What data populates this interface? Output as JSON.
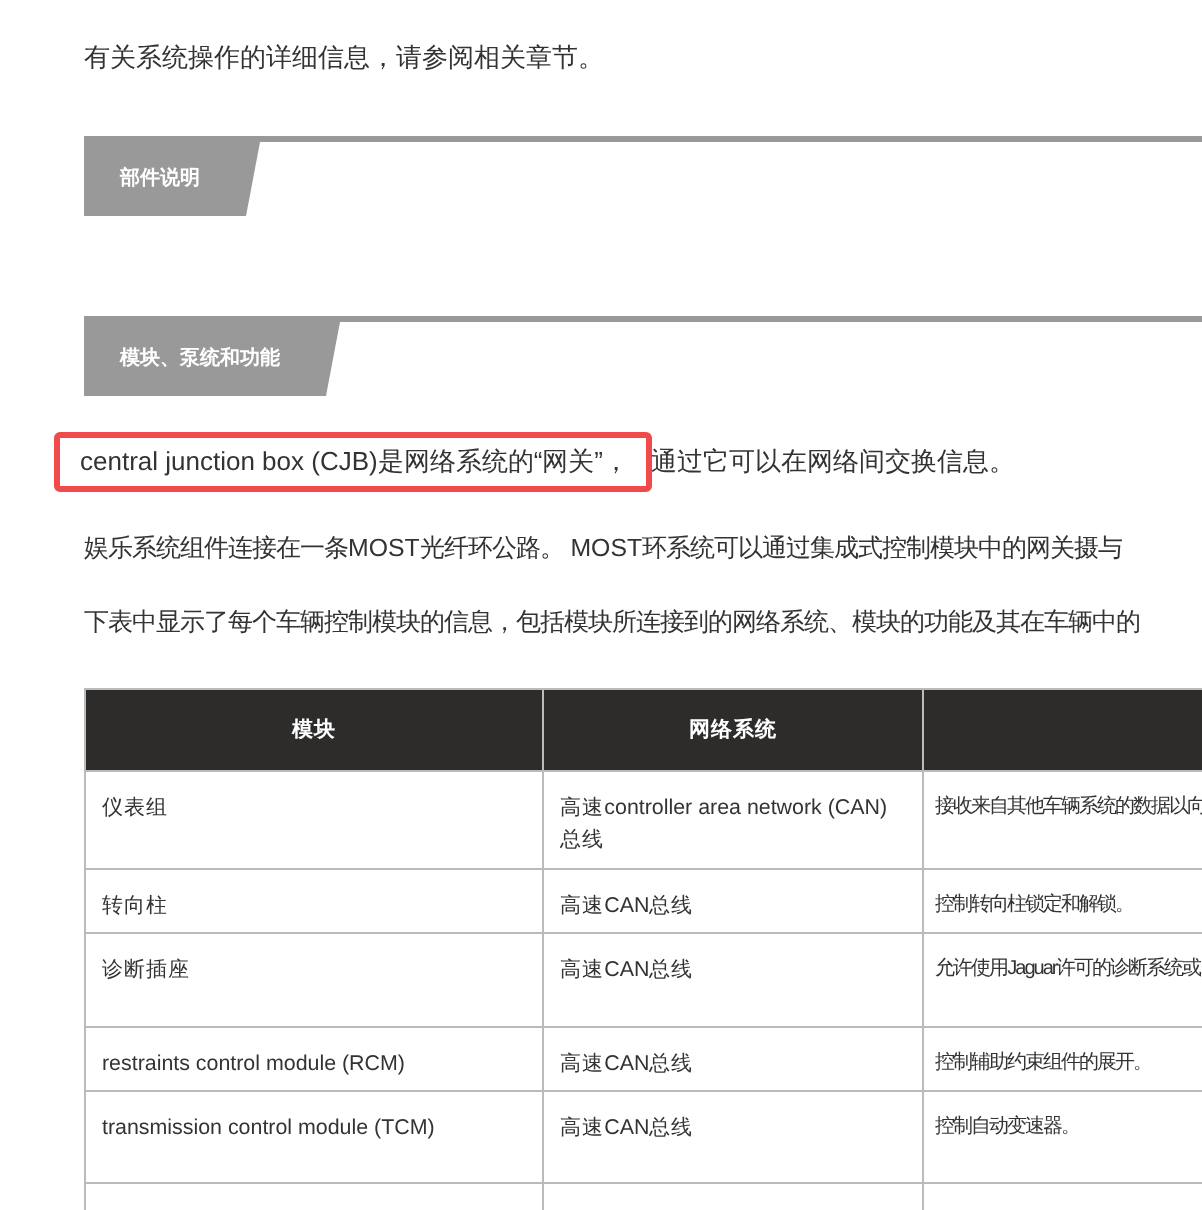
{
  "intro": "有关系统操作的详细信息，请参阅相关章节。",
  "sections": [
    {
      "title": "部件说明"
    },
    {
      "title": "模块、泵统和功能"
    }
  ],
  "highlight": {
    "marked": "central junction box (CJB)是网络系统的“网关”，",
    "rest": "通过它可以在网络间交换信息。"
  },
  "paragraphs": [
    "娱乐系统组件连接在一条MOST光纤环公路。 MOST环系统可以通过集成式控制模块中的网关摄与",
    "下表中显示了每个车辆控制模块的信息，包括模块所连接到的网络系统、模块的功能及其在车辆中的"
  ],
  "table": {
    "columns": [
      "模块",
      "网络系统"
    ],
    "rows": [
      [
        "仪表组",
        "高速controller area network (CAN)总线",
        "接收来自其他车辆系统的数据以向"
      ],
      [
        "转向柱",
        "高速CAN总线",
        "控制转向柱锁定和解锁。"
      ],
      [
        "诊断插座",
        "高速CAN总线",
        "允许使用Jaguar许可的诊断系统或"
      ],
      [
        "restraints control module (RCM)",
        "高速CAN总线",
        "控制辅助约束组件的展开。"
      ],
      [
        "transmission control module (TCM)",
        "高速CAN总线",
        "控制自动变速器。"
      ]
    ]
  }
}
